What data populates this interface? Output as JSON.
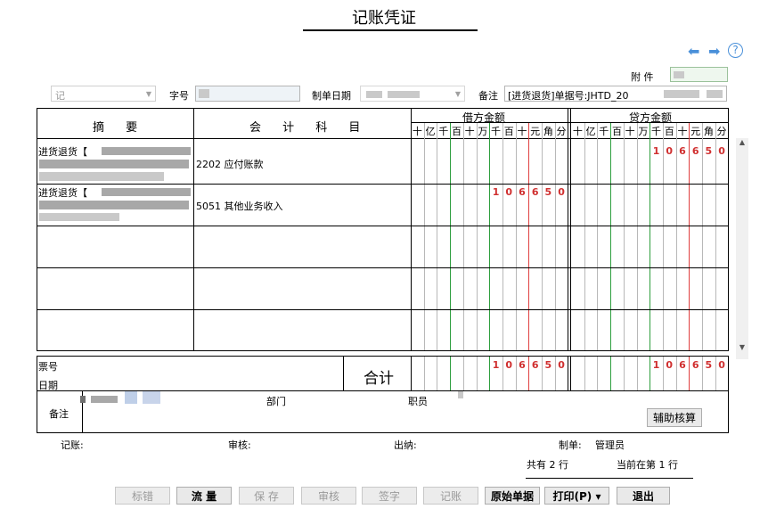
{
  "header": {
    "title": "记账凭证",
    "attachment_label": "附 件",
    "voucher_type": "记",
    "number_label": "字号",
    "date_label": "制单日期",
    "remark_label": "备注",
    "remark_value": "[进货退货]单据号:JHTD_20"
  },
  "table": {
    "summary_header": "摘 要",
    "account_header": "会 计 科 目",
    "debit_header": "借方金额",
    "credit_header": "贷方金额",
    "digit_units": [
      "十",
      "亿",
      "千",
      "百",
      "十",
      "万",
      "千",
      "百",
      "十",
      "元",
      "角",
      "分"
    ],
    "rows": [
      {
        "summary": "进货退货【",
        "account": "2202 应付账款",
        "debit": "",
        "credit": "106650"
      },
      {
        "summary": "进货退货【",
        "account": "5051 其他业务收入",
        "debit": "106650",
        "credit": ""
      },
      {
        "summary": "",
        "account": "",
        "debit": "",
        "credit": ""
      },
      {
        "summary": "",
        "account": "",
        "debit": "",
        "credit": ""
      },
      {
        "summary": "",
        "account": "",
        "debit": "",
        "credit": ""
      }
    ]
  },
  "totals": {
    "ticket_label": "票号",
    "date_label": "日期",
    "total_label": "合计",
    "debit_total": "106650",
    "credit_total": "106650"
  },
  "remark_section": {
    "remark_label": "备注",
    "dept_label": "部门",
    "staff_label": "职员",
    "aux_button": "辅助核算"
  },
  "signatures": {
    "bookkeep": "记账:",
    "audit": "审核:",
    "cashier": "出纳:",
    "maker": "制单:",
    "maker_name": "管理员"
  },
  "status": {
    "total_rows": "共有 2 行",
    "current_row": "当前在第 1 行"
  },
  "toolbar": [
    {
      "label": "标错",
      "enabled": false
    },
    {
      "label": "流 量",
      "enabled": true
    },
    {
      "label": "保 存",
      "enabled": false
    },
    {
      "label": "审核",
      "enabled": false
    },
    {
      "label": "签字",
      "enabled": false
    },
    {
      "label": "记账",
      "enabled": false
    },
    {
      "label": "原始单据",
      "enabled": true
    },
    {
      "label": "打印(P) ▾",
      "enabled": true
    },
    {
      "label": "退出",
      "enabled": true
    }
  ],
  "icons": {
    "back": "arrow-left-icon",
    "forward": "arrow-right-icon",
    "help": "help-icon"
  },
  "colors": {
    "accent_blue": "#4a90d9",
    "amount_red": "#d03030",
    "green_line": "#2e9e3e",
    "red_line": "#e04040"
  }
}
